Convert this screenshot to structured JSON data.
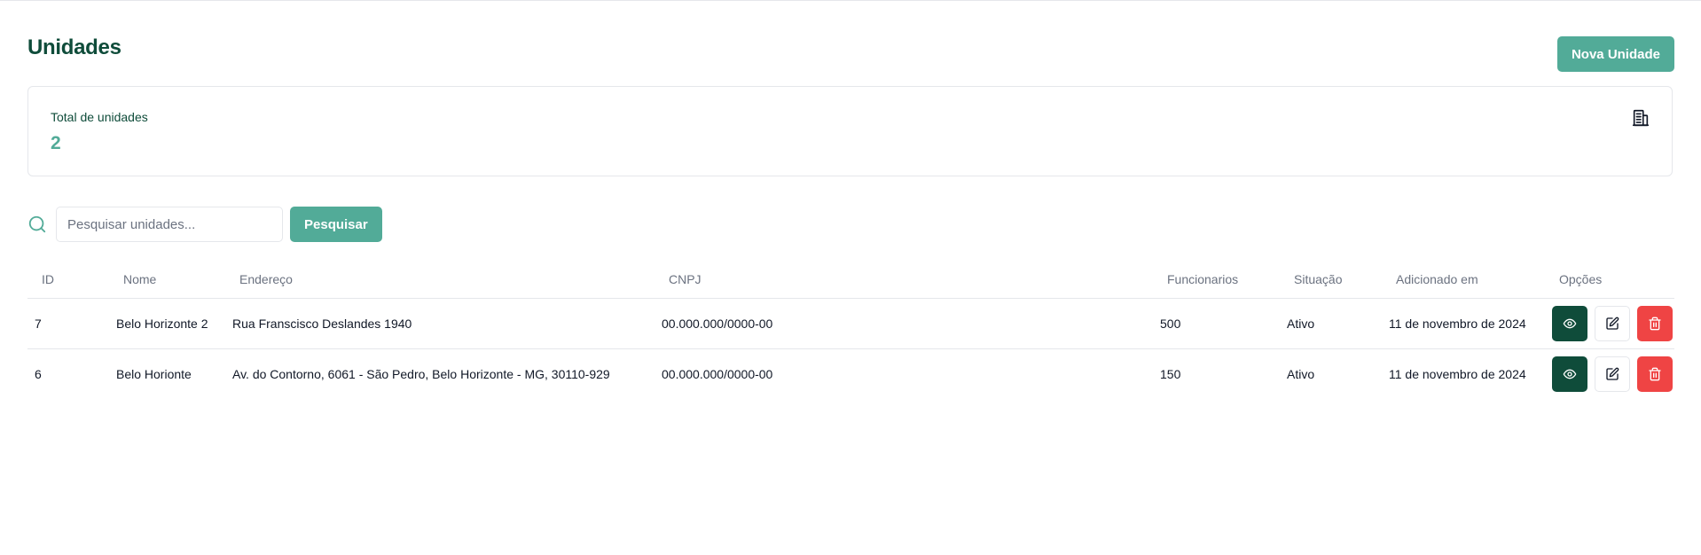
{
  "header": {
    "title": "Unidades",
    "new_button_label": "Nova Unidade"
  },
  "summary": {
    "label": "Total de unidades",
    "value": "2",
    "icon": "building-icon"
  },
  "search": {
    "placeholder": "Pesquisar unidades...",
    "value": "",
    "button_label": "Pesquisar",
    "icon": "search-icon"
  },
  "table": {
    "columns": [
      "ID",
      "Nome",
      "Endereço",
      "CNPJ",
      "Funcionarios",
      "Situação",
      "Adicionado em",
      "Opções"
    ],
    "rows": [
      {
        "id": "7",
        "nome": "Belo Horizonte 2",
        "endereco": "Rua Franscisco Deslandes 1940",
        "cnpj": "00.000.000/0000-00",
        "funcionarios": "500",
        "situacao": "Ativo",
        "adicionado": "11 de novembro de 2024"
      },
      {
        "id": "6",
        "nome": "Belo Horionte",
        "endereco": "Av. do Contorno, 6061 - São Pedro, Belo Horizonte - MG, 30110-929",
        "cnpj": "00.000.000/0000-00",
        "funcionarios": "150",
        "situacao": "Ativo",
        "adicionado": "11 de novembro de 2024"
      }
    ],
    "actions": [
      "eye-icon",
      "edit-icon",
      "trash-icon"
    ]
  },
  "colors": {
    "brand_dark": "#0f4c3a",
    "brand": "#52ab98",
    "danger": "#ef4444",
    "border": "#e5e7eb",
    "muted": "#6b7280"
  }
}
